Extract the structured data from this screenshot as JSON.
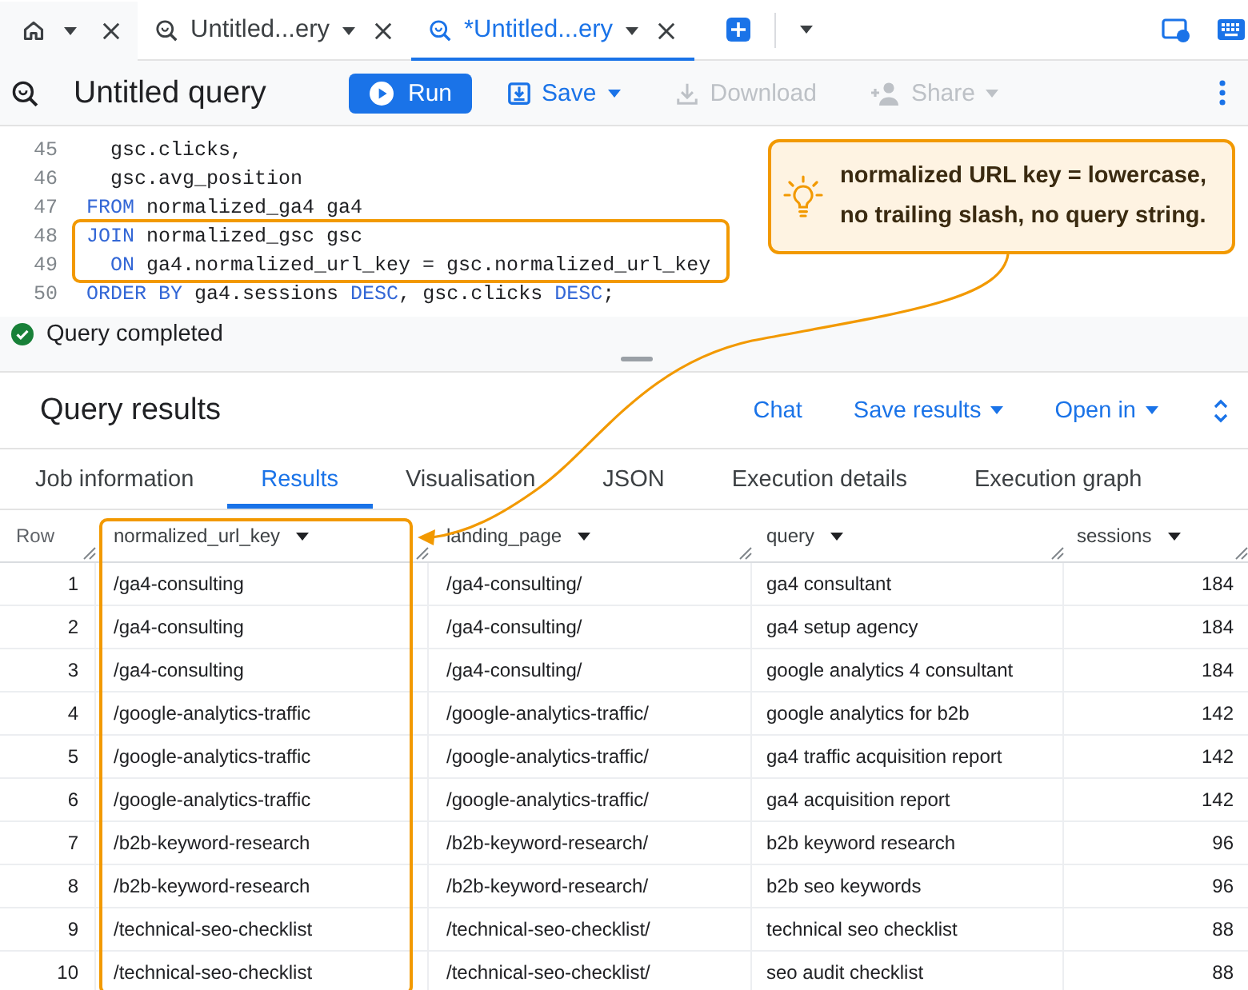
{
  "tab_bar": {
    "tabs": [
      {
        "kind": "home",
        "selected": false
      },
      {
        "kind": "query",
        "label": "Untitled...ery",
        "selected": false
      },
      {
        "kind": "query",
        "label": "*Untitled...ery",
        "selected": true
      }
    ]
  },
  "toolbar": {
    "title": "Untitled query",
    "buttons": [
      {
        "kind": "run",
        "label": "Run",
        "disabled": false,
        "dropdown": false
      },
      {
        "kind": "save",
        "label": "Save",
        "disabled": false,
        "dropdown": true
      },
      {
        "kind": "download",
        "label": "Download",
        "disabled": true,
        "dropdown": false
      },
      {
        "kind": "share",
        "label": "Share",
        "disabled": true,
        "dropdown": true
      }
    ]
  },
  "editor": {
    "lines": [
      {
        "number": "45",
        "highlighted": false,
        "tokens": [
          {
            "kind": "plain",
            "text": "  gsc.clicks,"
          }
        ]
      },
      {
        "number": "46",
        "highlighted": false,
        "tokens": [
          {
            "kind": "plain",
            "text": "  gsc.avg_position"
          }
        ]
      },
      {
        "number": "47",
        "highlighted": false,
        "tokens": [
          {
            "kind": "keyword",
            "text": "FROM"
          },
          {
            "kind": "plain",
            "text": " normalized_ga4 ga4"
          }
        ]
      },
      {
        "number": "48",
        "highlighted": true,
        "tokens": [
          {
            "kind": "keyword",
            "text": "JOIN"
          },
          {
            "kind": "plain",
            "text": " normalized_gsc gsc"
          }
        ]
      },
      {
        "number": "49",
        "highlighted": true,
        "tokens": [
          {
            "kind": "keyword",
            "text": "  ON"
          },
          {
            "kind": "plain",
            "text": " ga4.normalized_url_key = gsc.normalized_url_key"
          }
        ]
      },
      {
        "number": "50",
        "highlighted": false,
        "tokens": [
          {
            "kind": "keyword",
            "text": "ORDER BY"
          },
          {
            "kind": "plain",
            "text": " ga4.sessions "
          },
          {
            "kind": "keyword",
            "text": "DESC"
          },
          {
            "kind": "plain",
            "text": ", gsc.clicks "
          },
          {
            "kind": "keyword",
            "text": "DESC"
          },
          {
            "kind": "plain",
            "text": ";"
          }
        ]
      }
    ]
  },
  "status": {
    "kind": "success",
    "text": "Query completed"
  },
  "callout": {
    "text": "normalized URL key = lowercase, no trailing slash, no query string."
  },
  "results": {
    "title": "Query results",
    "actions": [
      {
        "label": "Chat",
        "dropdown": false
      },
      {
        "label": "Save results",
        "dropdown": true
      },
      {
        "label": "Open in",
        "dropdown": true
      }
    ],
    "tabs": [
      {
        "label": "Job information",
        "selected": false
      },
      {
        "label": "Results",
        "selected": true
      },
      {
        "label": "Visualisation",
        "selected": false
      },
      {
        "label": "JSON",
        "selected": false
      },
      {
        "label": "Execution details",
        "selected": false
      },
      {
        "label": "Execution graph",
        "selected": false
      }
    ],
    "table": {
      "columns": [
        {
          "label": "Row",
          "kind": "index",
          "menu": false,
          "highlighted": false
        },
        {
          "label": "normalized_url_key",
          "kind": "text",
          "menu": true,
          "highlighted": true
        },
        {
          "label": "landing_page",
          "kind": "text",
          "menu": true,
          "highlighted": false
        },
        {
          "label": "query",
          "kind": "text",
          "menu": true,
          "highlighted": false
        },
        {
          "label": "sessions",
          "kind": "number",
          "menu": true,
          "highlighted": false
        }
      ],
      "rows": [
        [
          "1",
          "/ga4-consulting",
          "/ga4-consulting/",
          "ga4 consultant",
          "184"
        ],
        [
          "2",
          "/ga4-consulting",
          "/ga4-consulting/",
          "ga4 setup agency",
          "184"
        ],
        [
          "3",
          "/ga4-consulting",
          "/ga4-consulting/",
          "google analytics 4 consultant",
          "184"
        ],
        [
          "4",
          "/google-analytics-traffic",
          "/google-analytics-traffic/",
          "google analytics for b2b",
          "142"
        ],
        [
          "5",
          "/google-analytics-traffic",
          "/google-analytics-traffic/",
          "ga4 traffic acquisition report",
          "142"
        ],
        [
          "6",
          "/google-analytics-traffic",
          "/google-analytics-traffic/",
          "ga4 acquisition report",
          "142"
        ],
        [
          "7",
          "/b2b-keyword-research",
          "/b2b-keyword-research/",
          "b2b keyword research",
          "96"
        ],
        [
          "8",
          "/b2b-keyword-research",
          "/b2b-keyword-research/",
          "b2b seo keywords",
          "96"
        ],
        [
          "9",
          "/technical-seo-checklist",
          "/technical-seo-checklist/",
          "technical seo checklist",
          "88"
        ],
        [
          "10",
          "/technical-seo-checklist",
          "/technical-seo-checklist/",
          "seo audit checklist",
          "88"
        ]
      ]
    }
  }
}
